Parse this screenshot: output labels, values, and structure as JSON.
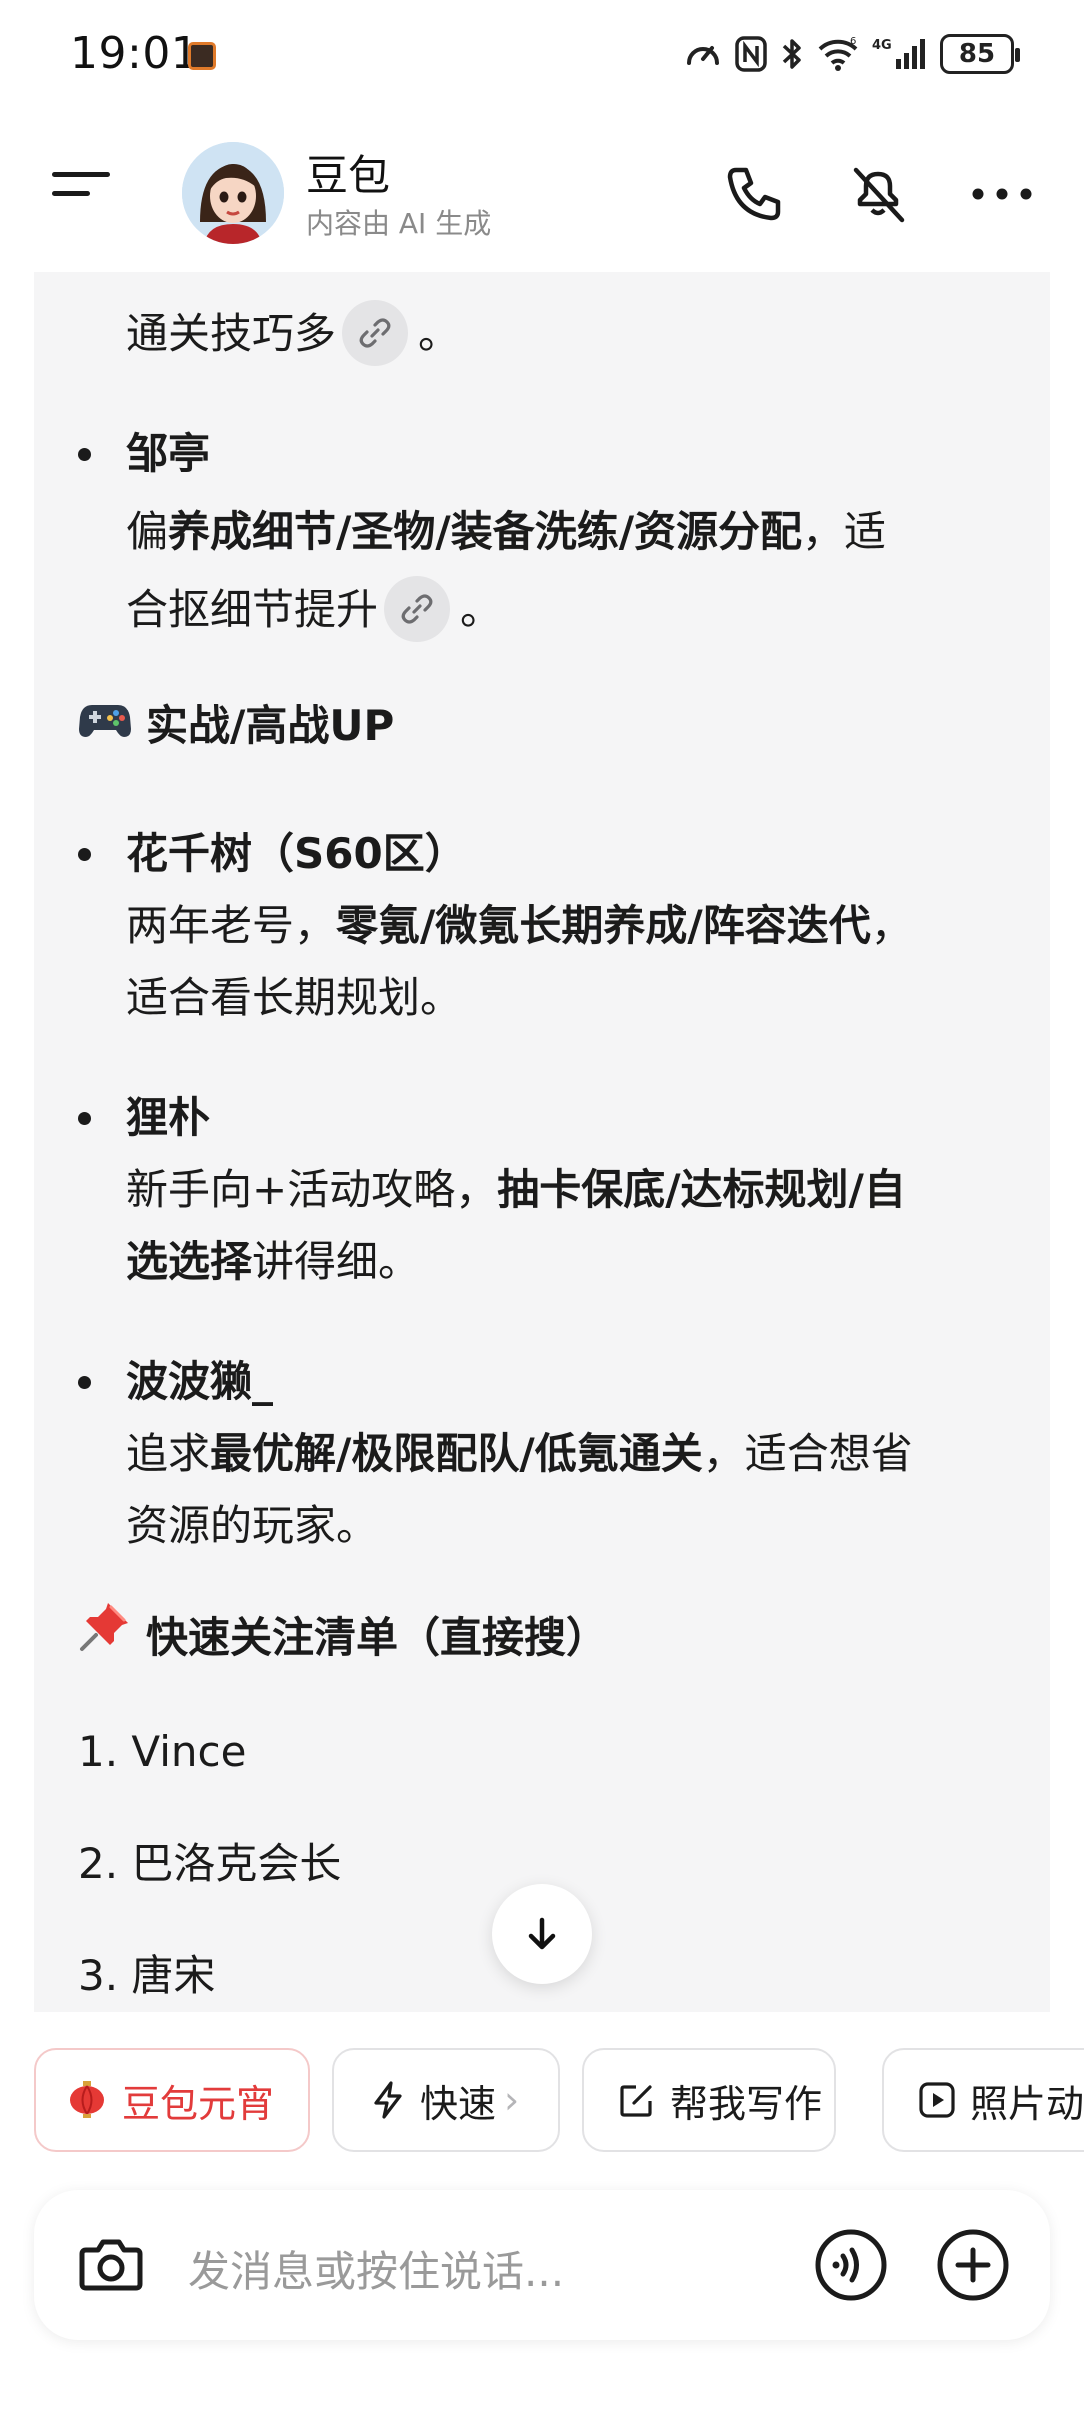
{
  "status_bar": {
    "time": "19:01",
    "battery": "85",
    "network": "4G",
    "icons": [
      "speed-icon",
      "nfc-icon",
      "bluetooth-icon",
      "wifi-icon",
      "signal-icon",
      "battery-icon"
    ]
  },
  "header": {
    "title": "豆包",
    "subtitle": "内容由 AI 生成",
    "icons": [
      "menu-icon",
      "phone-icon",
      "mute-icon",
      "more-icon"
    ]
  },
  "content": {
    "partial_line_a": "通关技巧多",
    "partial_line_a_end": "。",
    "item_zouting": {
      "name": "邹亭",
      "l2_pre": "偏",
      "l2_bold": "养成细节/圣物/装备洗练/资源分配",
      "l2_post": "，适",
      "l3": "合抠细节提升",
      "l3_end": "。"
    },
    "section_combat": {
      "emoji": "🎮",
      "title": "实战/高战UP"
    },
    "item_huaqianshu": {
      "name": "花千树（S60区）",
      "l2_pre": "两年老号，",
      "l2_bold": "零氪/微氪长期养成/阵容迭代",
      "l2_post": "，",
      "l3": "适合看长期规划。"
    },
    "item_lipu": {
      "name": "狸朴",
      "l2_pre": "新手向+活动攻略，",
      "l2_bold": "抽卡保底/达标规划/自",
      "l3_bold": "选选择",
      "l3_post": "讲得细。"
    },
    "item_bobota": {
      "name": "波波獭_",
      "l2_pre": "追求",
      "l2_bold": "最优解/极限配队/低氪通关",
      "l2_post": "，适合想省",
      "l3": "资源的玩家。"
    },
    "section_quick": {
      "emoji": "📌",
      "title": "快速关注清单（直接搜）"
    },
    "quick_list": [
      "1. Vince",
      "2. 巴洛克会长",
      "3. 唐宋"
    ]
  },
  "chips": [
    {
      "label": "豆包元宵",
      "icon": "lantern-icon"
    },
    {
      "label": "快速",
      "icon": "lightning-icon",
      "suffix": "›"
    },
    {
      "label": "帮我写作",
      "icon": "edit-icon"
    },
    {
      "label": "照片动",
      "icon": "play-icon"
    }
  ],
  "input": {
    "placeholder": "发消息或按住说话..."
  },
  "colors": {
    "accent_red": "#e23b3b",
    "card_bg": "#f5f5f6"
  }
}
